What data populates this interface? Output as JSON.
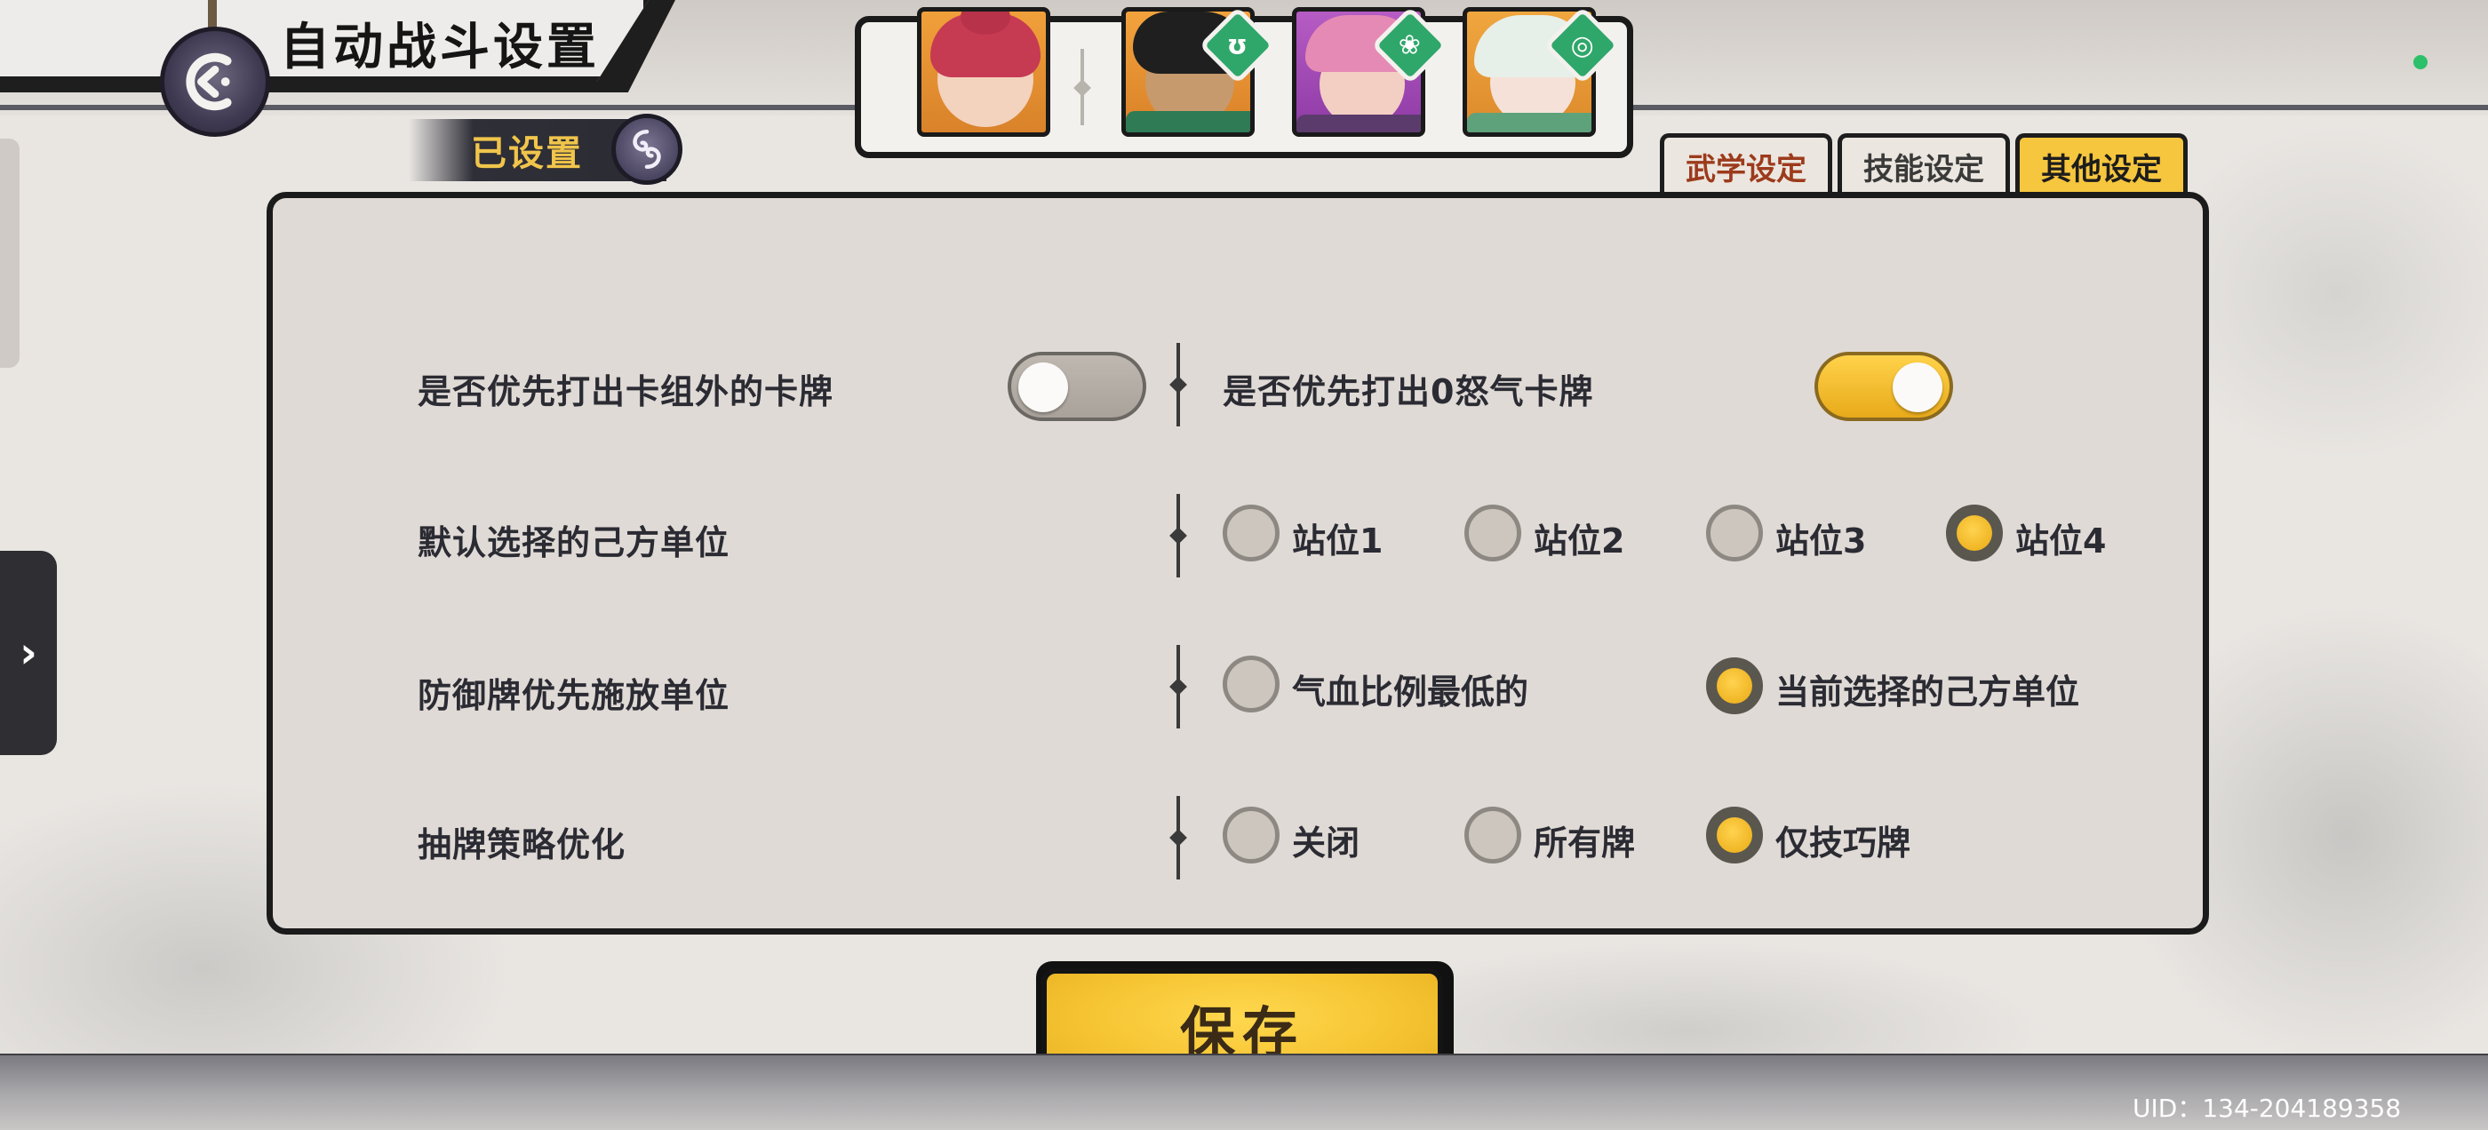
{
  "header": {
    "title": "自动战斗设置",
    "set_badge": "已设置"
  },
  "tabs": [
    {
      "label": "武学设定",
      "active": false
    },
    {
      "label": "技能设定",
      "active": false
    },
    {
      "label": "其他设定",
      "active": true
    }
  ],
  "settings": {
    "priority_outside_deck": {
      "label": "是否优先打出卡组外的卡牌",
      "enabled": false
    },
    "priority_zero_rage": {
      "label": "是否优先打出0怒气卡牌",
      "enabled": true
    },
    "default_unit": {
      "label": "默认选择的己方单位",
      "options": [
        "站位1",
        "站位2",
        "站位3",
        "站位4"
      ],
      "selected": "站位4"
    },
    "defense_target": {
      "label": "防御牌优先施放单位",
      "options": [
        "气血比例最低的",
        "当前选择的己方单位"
      ],
      "selected": "当前选择的己方单位"
    },
    "draw_strategy": {
      "label": "抽牌策略优化",
      "options": [
        "关闭",
        "所有牌",
        "仅技巧牌"
      ],
      "selected": "仅技巧牌"
    }
  },
  "save_label": "保存",
  "uid": "UID：134-204189358",
  "colors": {
    "accent": "#f6c63e",
    "panel": "#e0dad6",
    "outline": "#1b1b1b"
  }
}
